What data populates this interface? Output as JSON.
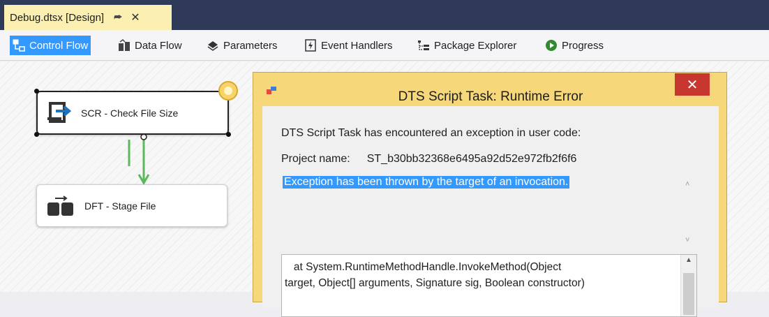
{
  "document_tab": {
    "label": "Debug.dtsx [Design]",
    "pin_icon": "pin-icon",
    "close_icon": "close-icon"
  },
  "designer_tabs": [
    {
      "label": "Control Flow",
      "icon": "control-flow-icon",
      "active": true
    },
    {
      "label": "Data Flow",
      "icon": "data-flow-icon",
      "active": false
    },
    {
      "label": "Parameters",
      "icon": "parameters-icon",
      "active": false
    },
    {
      "label": "Event Handlers",
      "icon": "event-handlers-icon",
      "active": false
    },
    {
      "label": "Package Explorer",
      "icon": "package-explorer-icon",
      "active": false
    },
    {
      "label": "Progress",
      "icon": "progress-icon",
      "active": false
    }
  ],
  "canvas": {
    "tasks": [
      {
        "label": "SCR - Check File Size",
        "icon": "script-task-icon",
        "selected": true
      },
      {
        "label": "DFT - Stage File",
        "icon": "data-flow-task-icon",
        "selected": false
      }
    ]
  },
  "dialog": {
    "title": "DTS Script Task: Runtime Error",
    "close_glyph": "✕",
    "message": "DTS Script Task has encountered an exception in user code:",
    "project_label": "Project name:",
    "project_value": "ST_b30bb32368e6495a92d52e972fb2f6f6",
    "exception": "Exception has been thrown by the target of an invocation.",
    "stack_trace": "   at System.RuntimeMethodHandle.InvokeMethod(Object\ntarget, Object[] arguments, Signature sig, Boolean constructor)"
  },
  "colors": {
    "title_bar": "#2f3a58",
    "doc_tab": "#fbf0b2",
    "active_tab": "#3399ff",
    "dialog_frame": "#f6d77a",
    "dialog_close": "#c7372f",
    "precedence_arrow": "#5cb85c"
  }
}
